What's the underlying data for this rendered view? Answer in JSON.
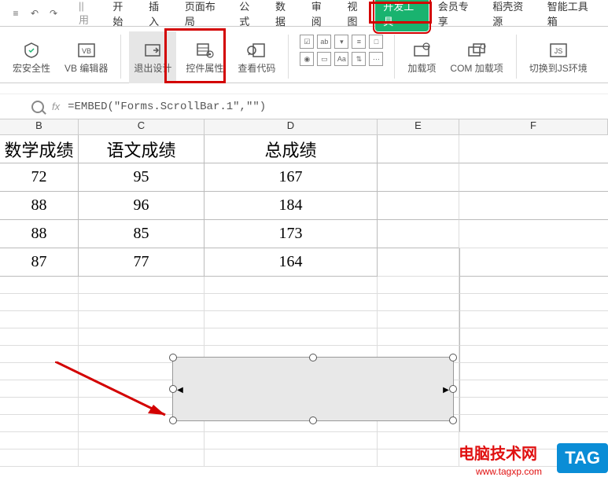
{
  "qat": {
    "doc": "≡"
  },
  "tabs": {
    "used": "|| 用",
    "start": "开始",
    "insert": "插入",
    "layout": "页面布局",
    "formula": "公式",
    "data": "数据",
    "review": "审阅",
    "view": "视图",
    "dev": "开发工具",
    "vip": "会员专享",
    "res": "稻壳资源",
    "tools": "智能工具箱"
  },
  "ribbon": {
    "security": "宏安全性",
    "vbeditor": "VB 编辑器",
    "exitdesign": "退出设计",
    "props": "控件属性",
    "viewcode": "查看代码",
    "addin": "加载项",
    "comaddin": "COM 加载项",
    "switchjs": "切换到JS环境"
  },
  "formula_bar": {
    "fx": "fx",
    "value": "=EMBED(\"Forms.ScrollBar.1\",\"\")"
  },
  "columns": {
    "B": "B",
    "C": "C",
    "D": "D",
    "E": "E",
    "F": "F"
  },
  "headers": {
    "math": "数学成绩",
    "chinese": "语文成绩",
    "total": "总成绩"
  },
  "rows": [
    {
      "math": "72",
      "chinese": "95",
      "total": "167"
    },
    {
      "math": "88",
      "chinese": "96",
      "total": "184"
    },
    {
      "math": "88",
      "chinese": "85",
      "total": "173"
    },
    {
      "math": "87",
      "chinese": "77",
      "total": "164"
    }
  ],
  "watermark": {
    "site": "电脑技术网",
    "url": "www.tagxp.com",
    "tag": "TAG"
  },
  "chart_data": {
    "type": "table",
    "columns": [
      "数学成绩",
      "语文成绩",
      "总成绩"
    ],
    "rows": [
      [
        72,
        95,
        167
      ],
      [
        88,
        96,
        184
      ],
      [
        88,
        85,
        173
      ],
      [
        87,
        77,
        164
      ]
    ]
  }
}
